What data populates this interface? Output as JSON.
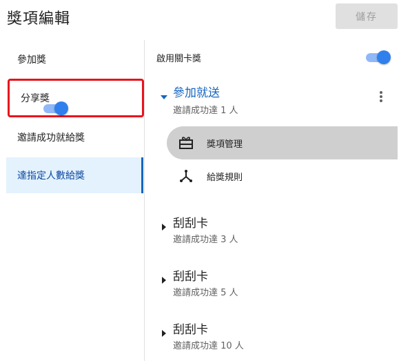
{
  "header": {
    "title": "獎項編輯",
    "save_label": "儲存"
  },
  "sidebar": {
    "items": [
      {
        "label": "參加獎"
      },
      {
        "label": "分享獎",
        "toggle_on": true
      },
      {
        "label": "邀請成功就給獎"
      },
      {
        "label": "達指定人數給獎"
      }
    ]
  },
  "main": {
    "enable_label": "啟用關卡獎",
    "enable_on": true,
    "groups": [
      {
        "title": "參加就送",
        "subtitle": "邀請成功達 1 人"
      },
      {
        "title": "刮刮卡",
        "subtitle": "邀請成功達 3 人"
      },
      {
        "title": "刮刮卡",
        "subtitle": "邀請成功達 5 人"
      },
      {
        "title": "刮刮卡",
        "subtitle": "邀請成功達 10 人"
      }
    ],
    "sub_items": [
      {
        "label": "獎項管理",
        "icon": "gift-card-icon"
      },
      {
        "label": "給獎規則",
        "icon": "branch-icon"
      }
    ]
  },
  "colors": {
    "accent": "#1565c0",
    "toggle": "#2f80ed",
    "highlight_border": "#e8131c",
    "active_bg": "#e3f2fd"
  }
}
